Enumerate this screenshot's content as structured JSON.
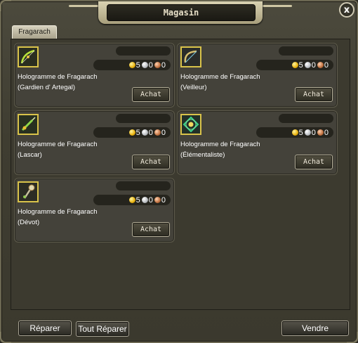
{
  "window": {
    "title": "Magasin",
    "close_label": "x"
  },
  "tabs": [
    {
      "label": "Fragarach"
    }
  ],
  "items": [
    {
      "name_line1": "Hologramme de Fragarach",
      "name_line2": "(Gardien d' Artegal)",
      "gold": "5",
      "silver": "0",
      "bronze": "0",
      "buy_label": "Achat",
      "icon": "bow-icon"
    },
    {
      "name_line1": "Hologramme de Fragarach",
      "name_line2": "(Veilleur)",
      "gold": "5",
      "silver": "0",
      "bronze": "0",
      "buy_label": "Achat",
      "icon": "longbow-icon"
    },
    {
      "name_line1": "Hologramme de Fragarach",
      "name_line2": "(Lascar)",
      "gold": "5",
      "silver": "0",
      "bronze": "0",
      "buy_label": "Achat",
      "icon": "dagger-icon"
    },
    {
      "name_line1": "Hologramme de Fragarach",
      "name_line2": "(Élémentaliste)",
      "gold": "5",
      "silver": "0",
      "bronze": "0",
      "buy_label": "Achat",
      "icon": "orb-icon"
    },
    {
      "name_line1": "Hologramme de Fragarach",
      "name_line2": "(Dévot)",
      "gold": "5",
      "silver": "0",
      "bronze": "0",
      "buy_label": "Achat",
      "icon": "staff-icon"
    }
  ],
  "bottom": {
    "repair_label": "Réparer",
    "repair_all_label": "Tout Réparer",
    "sell_label": "Vendre"
  },
  "colors": {
    "icon_border": "#d9c34a",
    "panel_bg": "#3c3a2f",
    "gold_coin": "#e8b00c",
    "silver_coin": "#b9bcc0",
    "bronze_coin": "#c0703f"
  }
}
